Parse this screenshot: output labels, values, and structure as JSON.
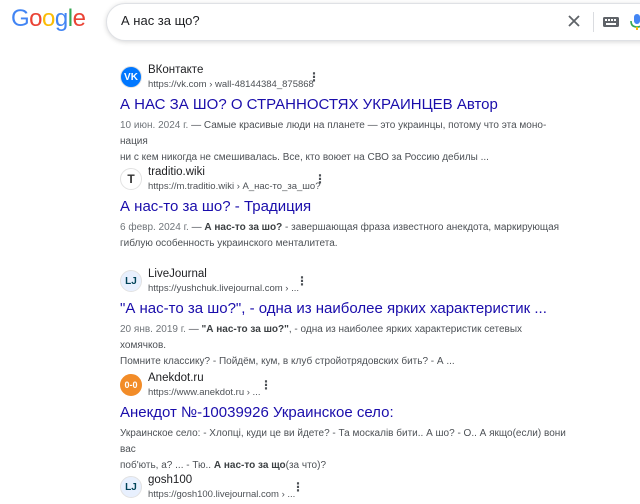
{
  "logo": {
    "letters": [
      {
        "ch": "G",
        "color": "#4285f4"
      },
      {
        "ch": "o",
        "color": "#ea4335"
      },
      {
        "ch": "o",
        "color": "#fbbc05"
      },
      {
        "ch": "g",
        "color": "#4285f4"
      },
      {
        "ch": "l",
        "color": "#34a853"
      },
      {
        "ch": "e",
        "color": "#ea4335"
      }
    ]
  },
  "search": {
    "query": "А нас за що?"
  },
  "results": [
    {
      "site": "ВКонтакте",
      "url": "https://vk.com › wall-48144384_875868",
      "favicon": "VK",
      "favicon_color": "#0077ff",
      "title": "А НАС ЗА ШО? О СТРАННОСТЯХ УКРАИНЦЕВ Автор",
      "date": "10 июн. 2024 г.",
      "snippet_line1": " — Самые красивые люди на планете — это украинцы, потому что эта моно-нация",
      "snippet_line2": "ни с кем никогда не смешивалась. Все, кто воюет на СВО за Россию дебилы ..."
    },
    {
      "site": "traditio.wiki",
      "url": "https://m.traditio.wiki › А_нас-то_за_шо?",
      "favicon": "T",
      "favicon_color": "#333333",
      "title": "А нас-то за шо? - Традиция",
      "date": "6 февр. 2024 г.",
      "snippet_bold": "А нас-то за шо?",
      "snippet_line1": " - завершающая фраза известного анекдота, маркирующая",
      "snippet_line2": "гиблую особенность украинского менталитета."
    },
    {
      "site": "LiveJournal",
      "url": "https://yushchuk.livejournal.com › ...",
      "favicon": "LJ",
      "favicon_color": "#004359",
      "title": "\"А нас-то за шо?\", - одна из наиболее ярких характеристик ...",
      "date": "20 янв. 2019 г.",
      "snippet_bold": "\"А нас-то за шо?\"",
      "snippet_line1": ", - одна из наиболее ярких характеристик сетевых хомячков.",
      "snippet_line2": "Помните классику? - Пойдём, кум, в клуб стройотрядовских бить? - А ..."
    },
    {
      "site": "Anekdot.ru",
      "url": "https://www.anekdot.ru › ...",
      "favicon": "0-0",
      "favicon_color": "#f28c28",
      "title": "Анекдот №-10039926 Украинское село:",
      "snippet_line1": "Украинское село: - Хлопці, куди це ви йдете? - Та москалів бити.. А шо? - О.. А якщо(если) вони вас",
      "snippet_line2a": "поб'ють, а? ... - Тю.. ",
      "snippet_bold2": "А нас-то за що",
      "snippet_line2b": "(за что)?"
    },
    {
      "site": "gosh100",
      "url": "https://gosh100.livejournal.com › ...",
      "favicon": "LJ",
      "favicon_color": "#004359"
    }
  ]
}
